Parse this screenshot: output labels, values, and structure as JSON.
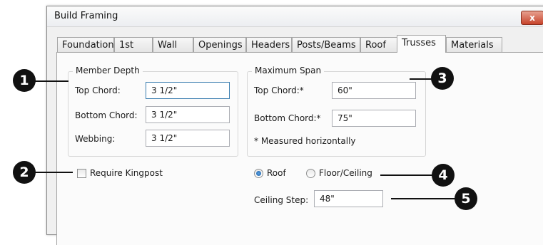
{
  "dialog": {
    "title": "Build Framing",
    "close_label": "x"
  },
  "tabs": [
    {
      "label": "Foundation"
    },
    {
      "label": "1st"
    },
    {
      "label": "Wall"
    },
    {
      "label": "Openings"
    },
    {
      "label": "Headers"
    },
    {
      "label": "Posts/Beams"
    },
    {
      "label": "Roof"
    },
    {
      "label": "Trusses",
      "active": true
    },
    {
      "label": "Materials"
    }
  ],
  "member_depth": {
    "legend": "Member Depth",
    "top_chord_label": "Top Chord:",
    "top_chord_value": "3 1/2\"",
    "bottom_chord_label": "Bottom Chord:",
    "bottom_chord_value": "3 1/2\"",
    "webbing_label": "Webbing:",
    "webbing_value": "3 1/2\""
  },
  "maximum_span": {
    "legend": "Maximum Span",
    "top_chord_label": "Top Chord:*",
    "top_chord_value": "60\"",
    "bottom_chord_label": "Bottom Chord:*",
    "bottom_chord_value": "75\"",
    "note": "* Measured horizontally"
  },
  "kingpost": {
    "label": "Require Kingpost",
    "checked": false
  },
  "truss_type": {
    "roof_label": "Roof",
    "floor_ceiling_label": "Floor/Ceiling",
    "selected": "Roof"
  },
  "ceiling_step": {
    "label": "Ceiling Step:",
    "value": "48\""
  },
  "callouts": [
    "1",
    "2",
    "3",
    "4",
    "5"
  ]
}
